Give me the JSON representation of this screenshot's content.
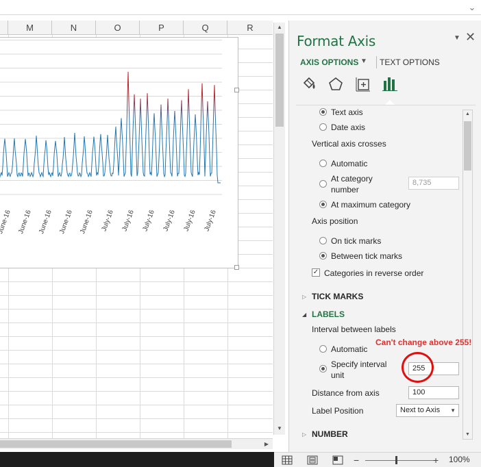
{
  "columns": [
    "M",
    "N",
    "O",
    "P",
    "Q",
    "R"
  ],
  "chart": {
    "x_tick_labels": [
      "June-16",
      "June-16",
      "June-16",
      "June-16",
      "June-16",
      "July-16",
      "July-16",
      "July-16",
      "July-16",
      "July-16",
      "July-16"
    ]
  },
  "pane": {
    "title": "Format Axis",
    "tabs": {
      "axis_options": "AXIS OPTIONS",
      "text_options": "TEXT OPTIONS"
    },
    "icons": [
      "fill-line-icon",
      "effects-icon",
      "size-properties-icon",
      "axis-options-icon"
    ],
    "axis_type": {
      "text_axis": "Text axis",
      "date_axis": "Date axis"
    },
    "vertical_axis_crosses": {
      "label": "Vertical axis crosses",
      "automatic": "Automatic",
      "at_category_number_1": "At category",
      "at_category_number_2": "number",
      "category_value": "8,735",
      "at_maximum": "At maximum category"
    },
    "axis_position": {
      "label": "Axis position",
      "on_tick": "On tick marks",
      "between_tick": "Between tick marks"
    },
    "reverse_order": "Categories in reverse order",
    "tick_marks": "TICK MARKS",
    "labels": {
      "header": "LABELS",
      "interval_label": "Interval between labels",
      "automatic": "Automatic",
      "specify_1": "Specify interval",
      "specify_2": "unit",
      "specify_value": "255",
      "distance_label": "Distance from axis",
      "distance_value": "100",
      "position_label": "Label Position",
      "position_value": "Next to Axis"
    },
    "number": "NUMBER"
  },
  "annotation": "Can't change above 255!",
  "statusbar": {
    "zoom": "100%",
    "minus": "−",
    "plus": "+"
  },
  "colors": {
    "accent": "#217346",
    "series_blue": "#1f77b4",
    "series_red": "#c0202a",
    "annotation": "#e03030"
  }
}
